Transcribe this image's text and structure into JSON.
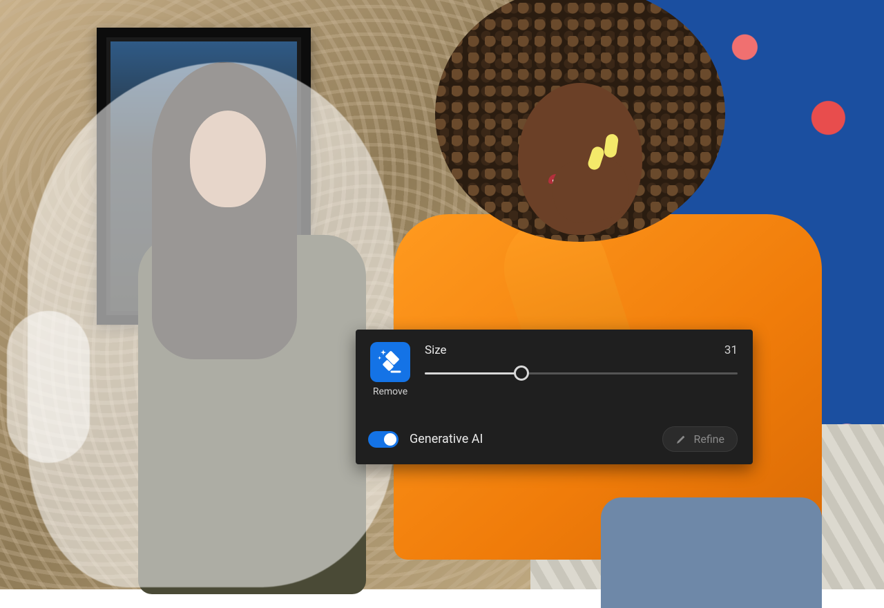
{
  "panel": {
    "tool": {
      "icon_name": "eraser-sparkle-icon",
      "label": "Remove"
    },
    "size": {
      "label": "Size",
      "value": "31",
      "percent": 31
    },
    "generative_ai": {
      "label": "Generative AI",
      "enabled": true
    },
    "refine": {
      "label": "Refine",
      "enabled": false
    }
  },
  "colors": {
    "accent": "#1473e6",
    "panel_bg": "#1f1f1f",
    "text": "#e8e8e8",
    "muted": "#8a8a8a"
  }
}
